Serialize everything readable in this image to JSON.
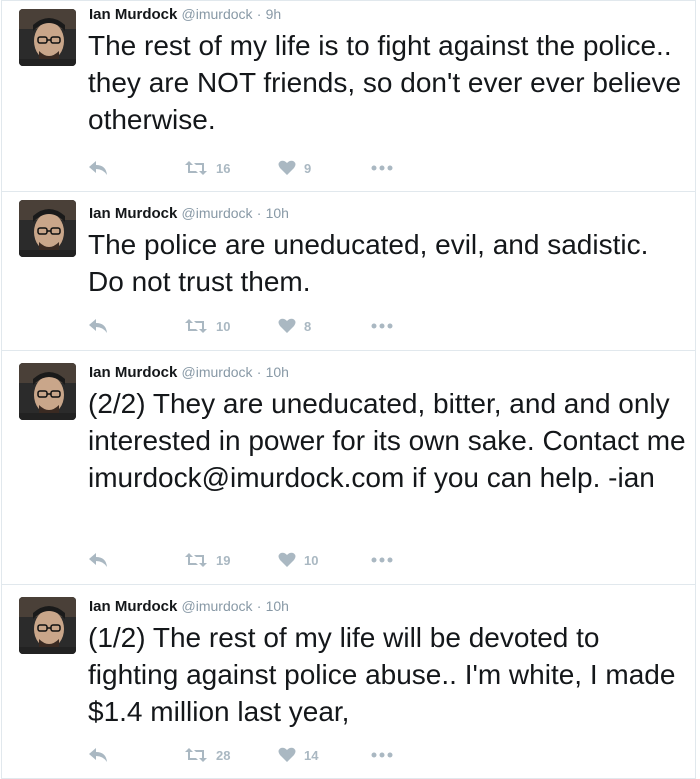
{
  "tweets": [
    {
      "name": "Ian Murdock",
      "handle": "@imurdock",
      "separator": "·",
      "time": "9h",
      "text": "The rest of my life is to fight against the police.. they are NOT friends, so don't ever ever believe otherwise.",
      "retweets": "16",
      "likes": "9"
    },
    {
      "name": "Ian Murdock",
      "handle": "@imurdock",
      "separator": "·",
      "time": "10h",
      "text": "The police are uneducated, evil, and sadistic. Do not trust them.",
      "retweets": "10",
      "likes": "8"
    },
    {
      "name": "Ian Murdock",
      "handle": "@imurdock",
      "separator": "·",
      "time": "10h",
      "text": "(2/2) They are uneducated, bitter, and and only interested in power for its own sake. Contact me imurdock@imurdock.com if you can help. -ian",
      "retweets": "19",
      "likes": "10"
    },
    {
      "name": "Ian Murdock",
      "handle": "@imurdock",
      "separator": "·",
      "time": "10h",
      "text": "(1/2) The rest of my life will be devoted to fighting against police abuse.. I'm white, I made $1.4 million last year,",
      "retweets": "28",
      "likes": "14"
    }
  ],
  "icons": {
    "reply": "reply-icon",
    "retweet": "retweet-icon",
    "like": "heart-icon",
    "more": "more-icon"
  },
  "colors": {
    "text": "#14171a",
    "muted": "#8899a6",
    "action": "#aab8c2",
    "border": "#e1e8ed"
  }
}
